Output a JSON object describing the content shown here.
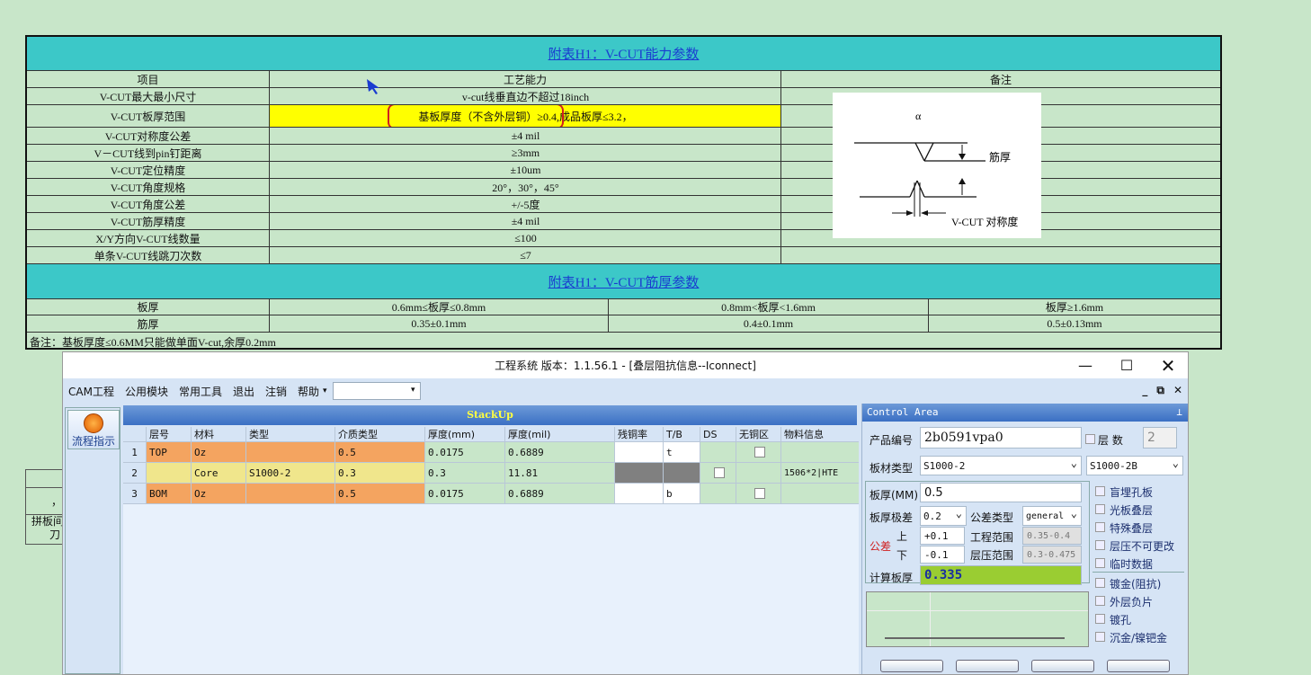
{
  "doc": {
    "table1_title": "附表H1：V-CUT能力参数",
    "col_headers": [
      "项目",
      "工艺能力",
      "备注"
    ],
    "rows": [
      {
        "item": "V-CUT最大最小尺寸",
        "cap": "v-cut线垂直边不超过18inch"
      },
      {
        "item": "V-CUT板厚范围",
        "cap": "基板厚度（不含外层铜）≥0.4,成品板厚≤3.2，"
      },
      {
        "item": "V-CUT对称度公差",
        "cap": "±4 mil"
      },
      {
        "item": "V－CUT线到pin钉距离",
        "cap": "≥3mm"
      },
      {
        "item": "V-CUT定位精度",
        "cap": "±10um"
      },
      {
        "item": "V-CUT角度规格",
        "cap": "20°，30°，45°"
      },
      {
        "item": "V-CUT角度公差",
        "cap": "+/-5度"
      },
      {
        "item": "V-CUT筋厚精度",
        "cap": "±4 mil"
      },
      {
        "item": "X/Y方向V-CUT线数量",
        "cap": "≤100"
      },
      {
        "item": "单条V-CUT线跳刀次数",
        "cap": "≤7"
      }
    ],
    "remark_img": {
      "alpha": "α",
      "rib": "筋厚",
      "sym": "V-CUT 对称度"
    },
    "table2_title": "附表H1：V-CUT筋厚参数",
    "t2_rows": [
      [
        "板厚",
        "0.6mm≤板厚≤0.8mm",
        "0.8mm<板厚<1.6mm",
        "板厚≥1.6mm"
      ],
      [
        "筋厚",
        "0.35±0.1mm",
        "0.4±0.1mm",
        "0.5±0.13mm"
      ]
    ],
    "note": "备注：基板厚度≤0.6MM只能做单面V-cut,余厚0.2mm"
  },
  "partial": {
    "l1": "，",
    "l2": "拼板间",
    "l3": "刀"
  },
  "app": {
    "title": "工程系统   版本：1.1.56.1 - [叠层阻抗信息--Iconnect]",
    "menu": [
      "CAM工程",
      "公用模块",
      "常用工具",
      "退出",
      "注销",
      "帮助"
    ],
    "flow_btn": "流程指示",
    "stackup_title": "StackUp",
    "grid_headers": [
      "",
      "层号",
      "材料",
      "类型",
      "介质类型",
      "厚度(mm)",
      "厚度(mil)",
      "残铜率",
      "T/B",
      "DS",
      "无铜区",
      "物料信息"
    ],
    "grid_rows": [
      {
        "n": "1",
        "layer": "TOP",
        "mat": "Oz",
        "type": "",
        "dtype": "0.5",
        "mm": "0.0175",
        "mil": "0.6889",
        "res": "",
        "tb": "t",
        "info": ""
      },
      {
        "n": "2",
        "layer": "",
        "mat": "Core",
        "type": "S1000-2",
        "dtype": "0.3",
        "mm": "0.3",
        "mil": "11.81",
        "res": "",
        "tb": "",
        "info": "1506*2|HTE"
      },
      {
        "n": "3",
        "layer": "BOM",
        "mat": "Oz",
        "type": "",
        "dtype": "0.5",
        "mm": "0.0175",
        "mil": "0.6889",
        "res": "",
        "tb": "b",
        "info": ""
      }
    ],
    "control": {
      "title": "Control Area",
      "pin": "ᵖ",
      "product_label": "产品编号",
      "product_value": "2b0591vpa0",
      "layers_label": "层 数",
      "layers_value": "2",
      "board_type_label": "板材类型",
      "board_type_value": "S1000-2",
      "board_type_value2": "S1000-2B",
      "thick_label": "板厚(MM)",
      "thick_value": "0.5",
      "tol_label": "板厚极差",
      "tol_value": "0.2",
      "tol_type_label": "公差类型",
      "tol_type_value": "general",
      "tolerance_label": "公差",
      "up_label": "上",
      "up_value": "+0.1",
      "down_label": "下",
      "down_value": "-0.1",
      "eng_range_label": "工程范围",
      "eng_range_value": "0.35-0.4",
      "lam_range_label": "层压范围",
      "lam_range_value": "0.3-0.475",
      "calc_label": "计算板厚",
      "calc_value": "0.335",
      "options": [
        "盲埋孔板",
        "光板叠层",
        "特殊叠层",
        "层压不可更改",
        "临时数据",
        "镀金(阻抗)",
        "外层负片",
        "镀孔",
        "沉金/镍钯金"
      ]
    }
  },
  "colors": {
    "bg": "#c8e6c9",
    "header": "#3cc8c8",
    "highlight": "#ffff00",
    "copper": "#f4a460",
    "core": "#f0e68c",
    "calc": "#9acd32"
  }
}
